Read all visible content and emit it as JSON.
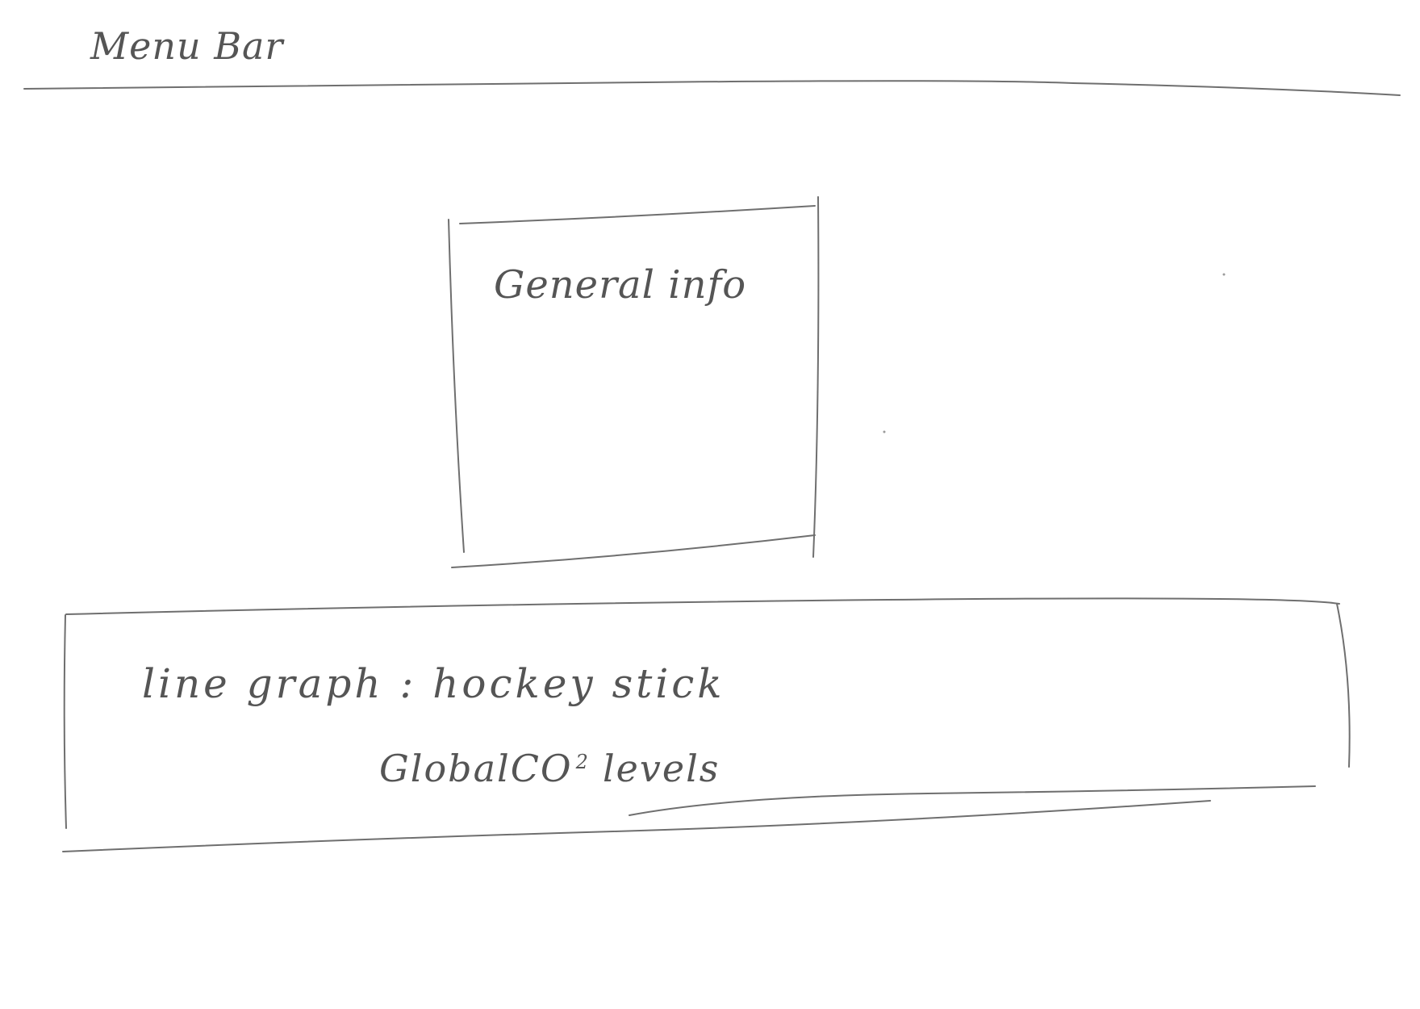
{
  "menu_bar": {
    "label": "Menu Bar"
  },
  "general_info": {
    "label": "General info"
  },
  "line_graph_panel": {
    "title": "line graph : hockey stick",
    "subtitle_main": "GlobalCO",
    "subtitle_sup": "2",
    "subtitle_end": "levels"
  },
  "colors": {
    "ink": "#6f6f6f",
    "paper": "#ffffff"
  }
}
